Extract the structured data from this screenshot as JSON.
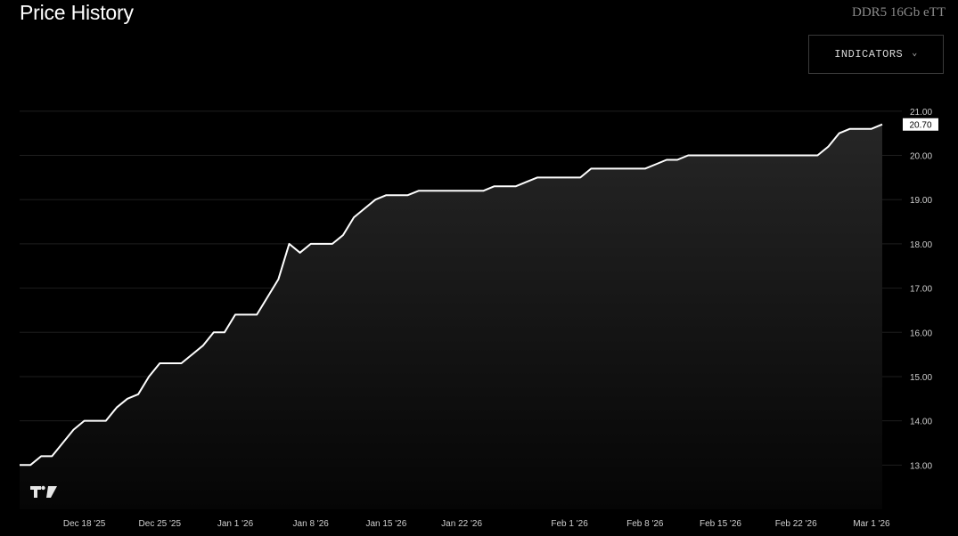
{
  "header": {
    "title": "Price History",
    "product": "DDR5 16Gb eTT",
    "indicators_label": "INDICATORS",
    "chevron_glyph": "⌄"
  },
  "colors": {
    "background": "#000000",
    "line": "#ffffff",
    "grid": "#1e1e1e",
    "area_top": "#262626",
    "area_bottom": "#050505"
  },
  "chart_data": {
    "type": "area",
    "title": "Price History",
    "xlabel": "",
    "ylabel": "",
    "grid": true,
    "ylim": [
      12.0,
      21.5
    ],
    "yticks": [
      "13.00",
      "14.00",
      "15.00",
      "16.00",
      "17.00",
      "18.00",
      "19.00",
      "20.00",
      "21.00"
    ],
    "xticks": [
      "Dec 18 '25",
      "Dec 25 '25",
      "Jan 1 '26",
      "Jan 8 '26",
      "Jan 15 '26",
      "Jan 22 '26",
      "Feb 1 '26",
      "Feb 8 '26",
      "Feb 15 '26",
      "Feb 22 '26",
      "Mar 1 '26"
    ],
    "last_price_label": "20.70",
    "series": [
      {
        "x": [
          "2025-12-12",
          "2025-12-13",
          "2025-12-14",
          "2025-12-15",
          "2025-12-16",
          "2025-12-17",
          "2025-12-18",
          "2025-12-19",
          "2025-12-20",
          "2025-12-21",
          "2025-12-22",
          "2025-12-23",
          "2025-12-24",
          "2025-12-25",
          "2025-12-26",
          "2025-12-27",
          "2025-12-28",
          "2025-12-29",
          "2025-12-30",
          "2025-12-31",
          "2026-01-01",
          "2026-01-02",
          "2026-01-03",
          "2026-01-04",
          "2026-01-05",
          "2026-01-06",
          "2026-01-07",
          "2026-01-08",
          "2026-01-09",
          "2026-01-10",
          "2026-01-11",
          "2026-01-12",
          "2026-01-13",
          "2026-01-14",
          "2026-01-15",
          "2026-01-16",
          "2026-01-17",
          "2026-01-18",
          "2026-01-19",
          "2026-01-20",
          "2026-01-21",
          "2026-01-22",
          "2026-01-23",
          "2026-01-24",
          "2026-01-25",
          "2026-01-26",
          "2026-01-27",
          "2026-01-28",
          "2026-01-29",
          "2026-01-30",
          "2026-01-31",
          "2026-02-01",
          "2026-02-02",
          "2026-02-03",
          "2026-02-04",
          "2026-02-05",
          "2026-02-06",
          "2026-02-07",
          "2026-02-08",
          "2026-02-09",
          "2026-02-10",
          "2026-02-11",
          "2026-02-12",
          "2026-02-13",
          "2026-02-14",
          "2026-02-15",
          "2026-02-16",
          "2026-02-17",
          "2026-02-18",
          "2026-02-19",
          "2026-02-20",
          "2026-02-21",
          "2026-02-22",
          "2026-02-23",
          "2026-02-24",
          "2026-02-25",
          "2026-02-26",
          "2026-02-27",
          "2026-02-28",
          "2026-03-01",
          "2026-03-02"
        ],
        "values": [
          13.0,
          13.0,
          13.2,
          13.2,
          13.5,
          13.8,
          14.0,
          14.0,
          14.0,
          14.3,
          14.5,
          14.6,
          15.0,
          15.3,
          15.3,
          15.3,
          15.5,
          15.7,
          16.0,
          16.0,
          16.4,
          16.4,
          16.4,
          16.8,
          17.2,
          18.0,
          17.8,
          18.0,
          18.0,
          18.0,
          18.2,
          18.6,
          18.8,
          19.0,
          19.1,
          19.1,
          19.1,
          19.2,
          19.2,
          19.2,
          19.2,
          19.2,
          19.2,
          19.2,
          19.3,
          19.3,
          19.3,
          19.4,
          19.5,
          19.5,
          19.5,
          19.5,
          19.5,
          19.7,
          19.7,
          19.7,
          19.7,
          19.7,
          19.7,
          19.8,
          19.9,
          19.9,
          20.0,
          20.0,
          20.0,
          20.0,
          20.0,
          20.0,
          20.0,
          20.0,
          20.0,
          20.0,
          20.0,
          20.0,
          20.0,
          20.2,
          20.5,
          20.6,
          20.6,
          20.6,
          20.7
        ]
      }
    ]
  }
}
